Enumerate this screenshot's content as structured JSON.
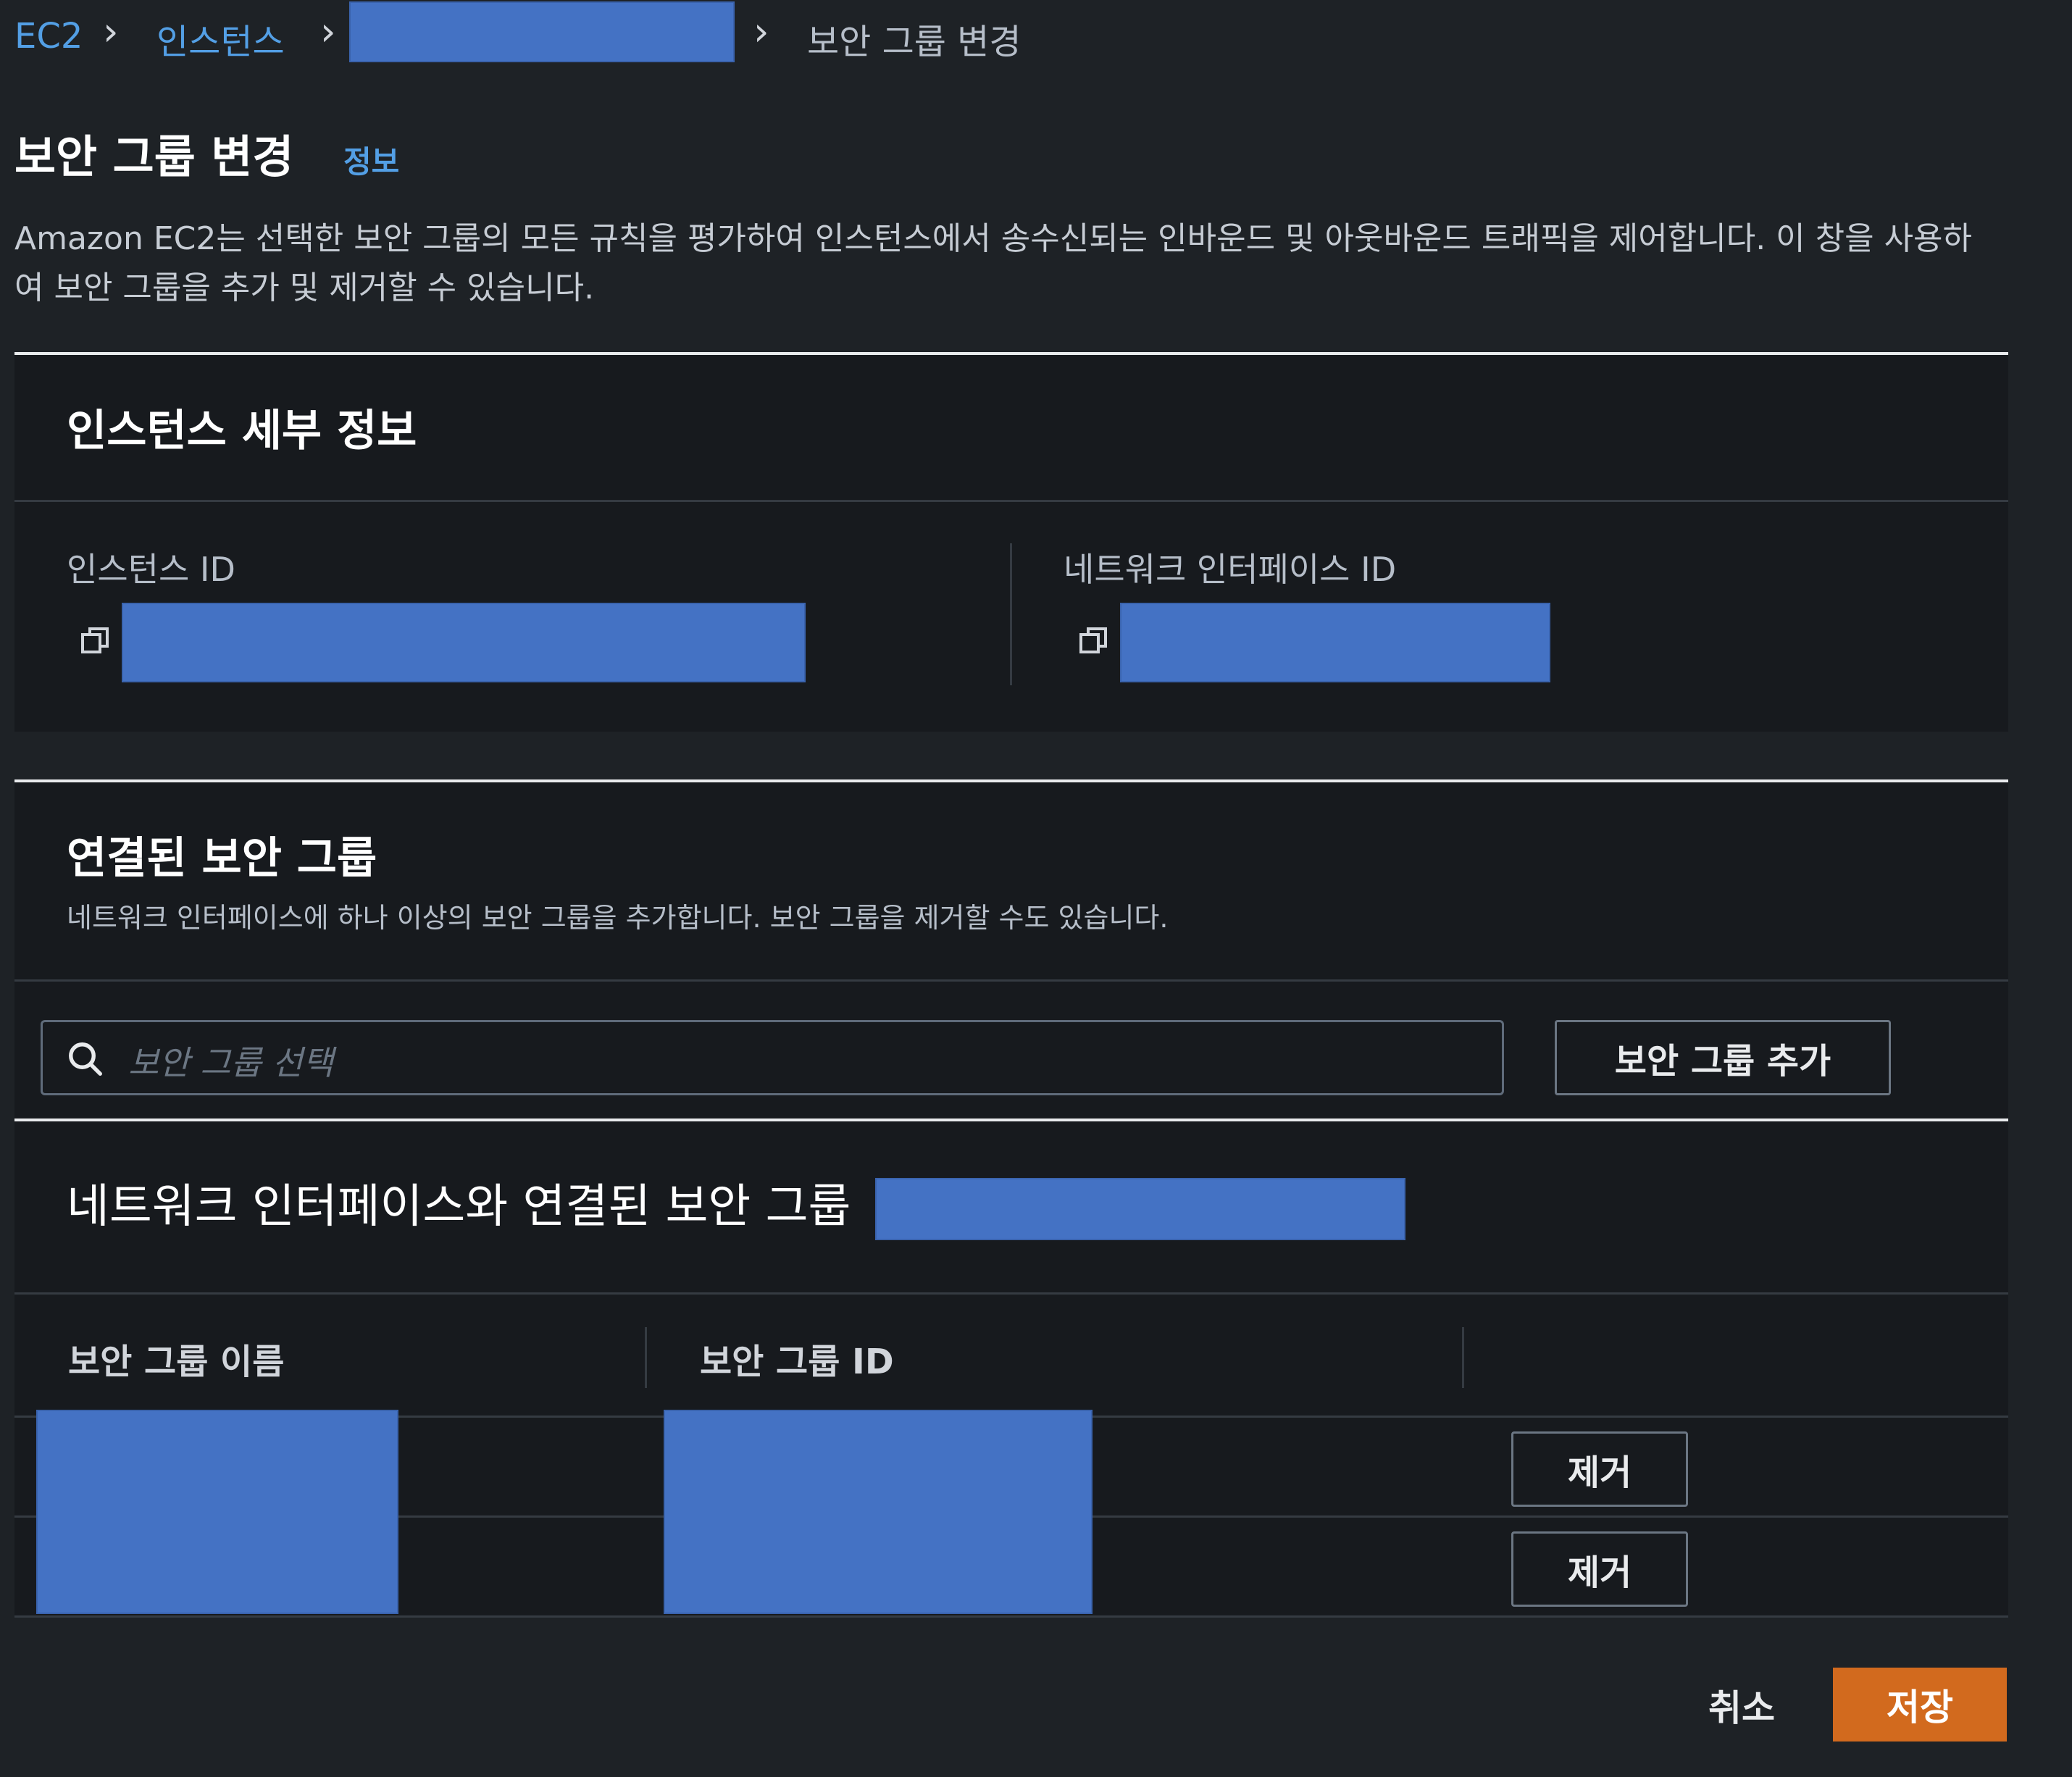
{
  "breadcrumb": {
    "items": [
      "EC2",
      "인스턴스"
    ],
    "current": "보안 그룹 변경"
  },
  "page": {
    "title": "보안 그룹 변경",
    "info_link": "정보",
    "description": "Amazon EC2는 선택한 보안 그룹의 모든 규칙을 평가하여 인스턴스에서 송수신되는 인바운드 및 아웃바운드 트래픽을 제어합니다. 이 창을 사용하여 보안 그룹을 추가 및 제거할 수 있습니다."
  },
  "instance_details": {
    "title": "인스턴스 세부 정보",
    "instance_id_label": "인스턴스 ID",
    "network_interface_id_label": "네트워크 인터페이스 ID"
  },
  "associated_groups": {
    "title": "연결된 보안 그룹",
    "description": "네트워크 인터페이스에 하나 이상의 보안 그룹을 추가합니다. 보안 그룹을 제거할 수도 있습니다.",
    "search_placeholder": "보안 그룹 선택",
    "add_button": "보안 그룹 추가"
  },
  "network_groups": {
    "title": "네트워크 인터페이스와 연결된 보안 그룹",
    "columns": [
      "보안 그룹 이름",
      "보안 그룹 ID"
    ],
    "remove_buttons": [
      "제거",
      "제거"
    ]
  },
  "footer": {
    "cancel": "취소",
    "save": "저장"
  },
  "colors": {
    "background": "#1e2226",
    "card": "#171a1e",
    "link": "#539fe5",
    "primary": "#d26a1e",
    "redacted": "#4472c4"
  },
  "icons": [
    "chevron-right-icon",
    "copy-icon",
    "search-icon"
  ]
}
